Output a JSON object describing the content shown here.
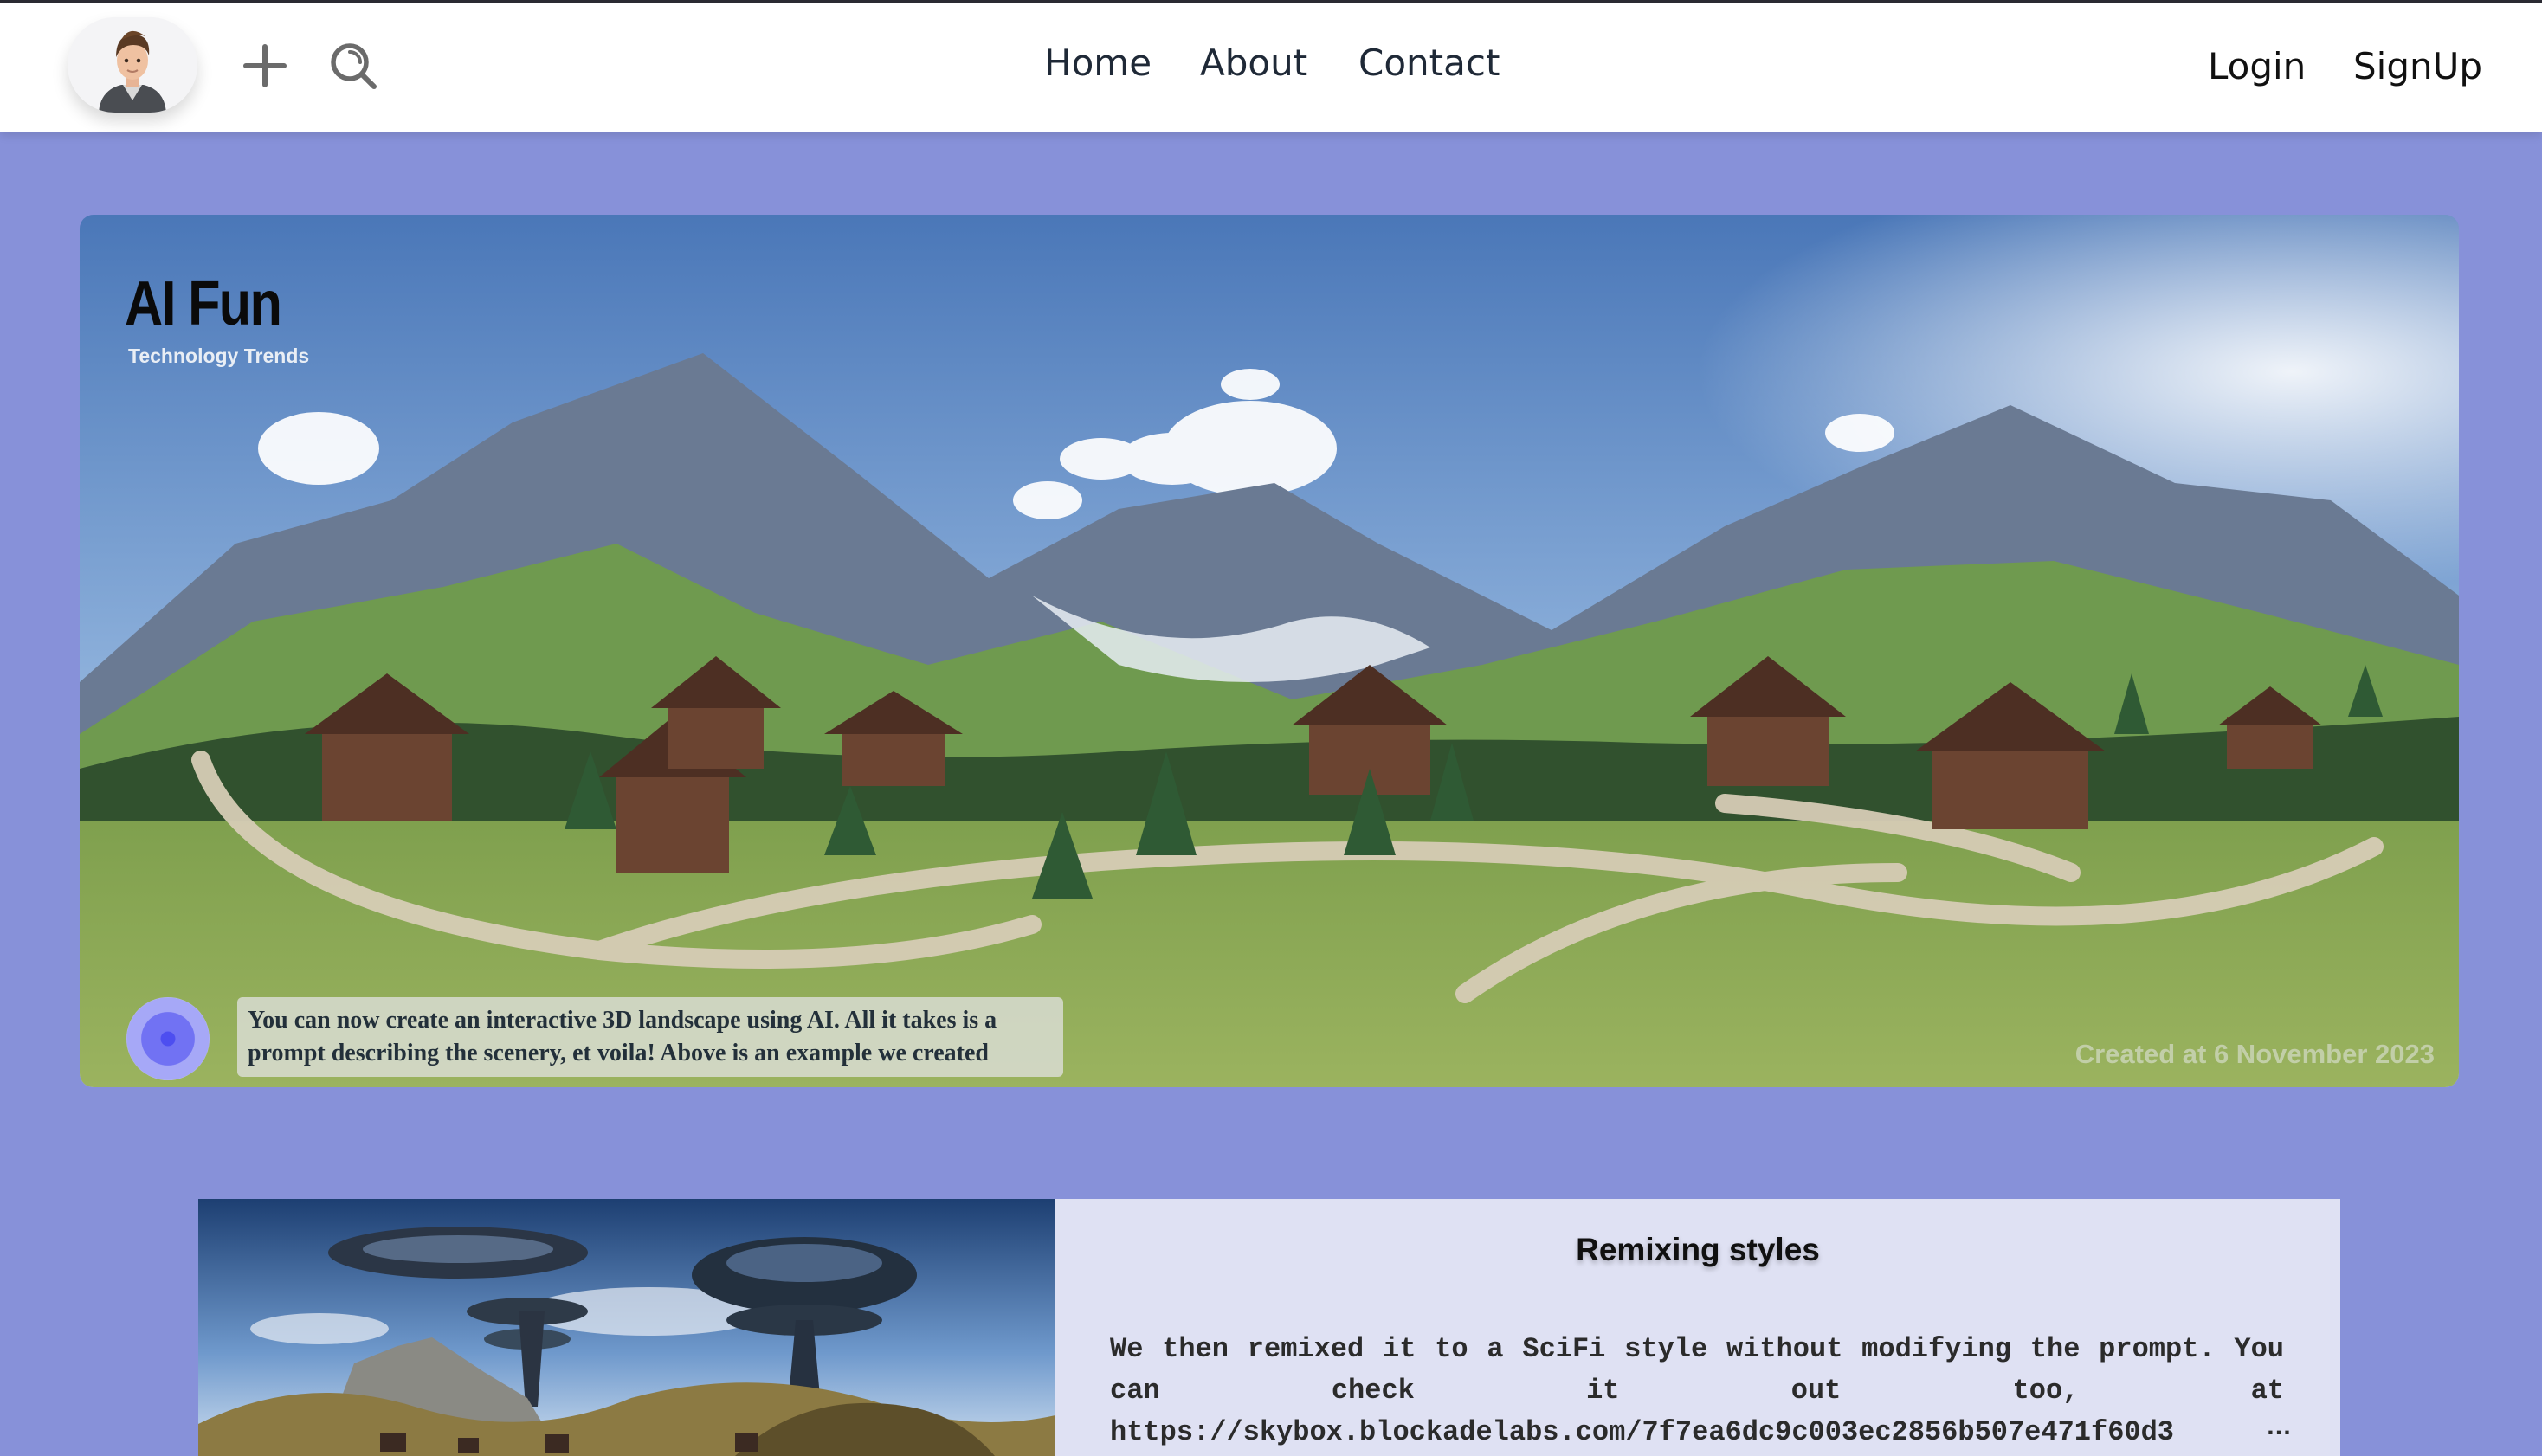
{
  "navbar": {
    "links": [
      "Home",
      "About",
      "Contact"
    ],
    "auth": {
      "login": "Login",
      "signup": "SignUp"
    },
    "icons": [
      "avatar",
      "plus-icon",
      "search-icon"
    ]
  },
  "hero": {
    "title": "AI Fun",
    "subtitle": "Technology Trends",
    "caption": "You can now create an interactive 3D landscape using AI. All it takes is a prompt describing the scenery, et voila! Above is an example we created",
    "date": "Created at 6 November 2023"
  },
  "card": {
    "title": "Remixing styles",
    "text": "We then remixed it to a SciFi style without modifying the prompt. You can check it out too, at https://skybox.blockadelabs.com/7f7ea6dc9c003ec2856b507e471f60d3",
    "ellipsis": "…"
  },
  "colors": {
    "page_background": "#8791d9",
    "navbar_background": "#ffffff",
    "card_background": "#dfe1f3"
  }
}
